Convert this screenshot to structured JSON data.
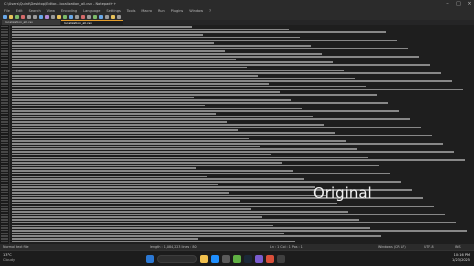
{
  "window": {
    "title": "C:\\Users\\Quint\\Desktop\\Editor...localization_all.csv - Notepad++",
    "controls": [
      "minimize",
      "maximize",
      "close"
    ]
  },
  "menu": {
    "items": [
      "File",
      "Edit",
      "Search",
      "View",
      "Encoding",
      "Language",
      "Settings",
      "Tools",
      "Macro",
      "Run",
      "Plugins",
      "Window",
      "?"
    ]
  },
  "tabs": [
    {
      "label": "localization_all.csv",
      "active": false
    },
    {
      "label": "localization_all.csv",
      "active": true
    }
  ],
  "overlay": {
    "label": "Original"
  },
  "status": {
    "left": "Normal text file",
    "middle": "length : 1,084,223    lines : 80",
    "position": "Ln : 1   Col : 1   Pos : 1",
    "eol": "Windows (CR LF)",
    "encoding": "UTF-8",
    "mode": "INS"
  },
  "taskbar": {
    "weather_temp": "13°C",
    "weather_desc": "Cloudy",
    "time": "10:16 PM",
    "date": "1/23/2025"
  },
  "colors": {
    "accent": "#e39d2c",
    "editor_bg": "#1e1e1e",
    "chrome_bg": "#2b2b2b"
  }
}
